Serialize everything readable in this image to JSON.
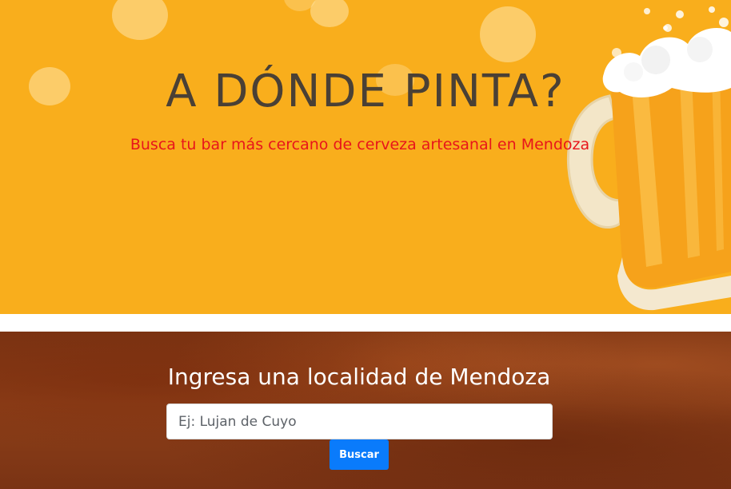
{
  "hero": {
    "title": "A DÓNDE PINTA?",
    "subtitle": "Busca tu bar más cercano de cerveza artesanal en Mendoza",
    "background_color": "#f9ae1c",
    "title_color": "#4a4035",
    "subtitle_color": "#e8151b",
    "illustration": "beer-mug-icon"
  },
  "search": {
    "heading": "Ingresa una localidad de Mendoza",
    "placeholder": "Ej: Lujan de Cuyo",
    "value": "",
    "button_label": "Buscar",
    "button_color": "#0a7bfb",
    "background": "wood-texture"
  }
}
